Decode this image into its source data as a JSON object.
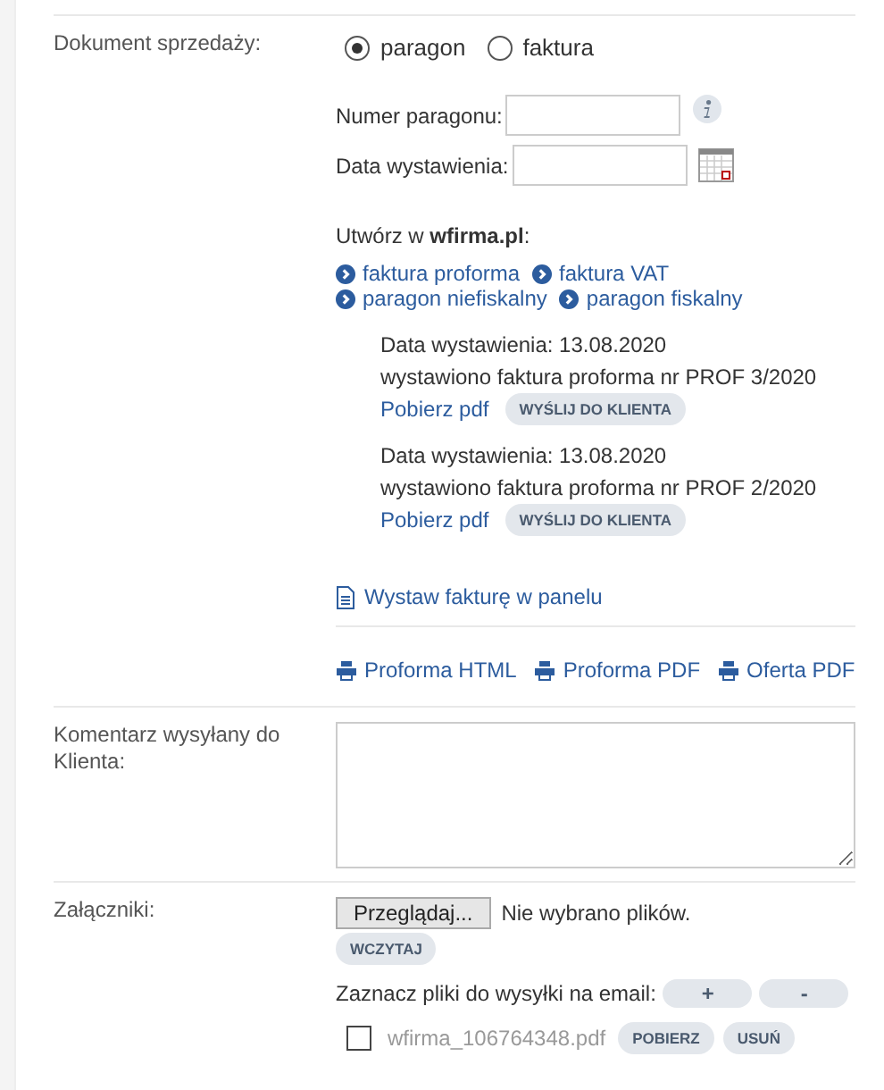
{
  "sales_document": {
    "label": "Dokument sprzedaży:",
    "options": [
      {
        "label": "paragon",
        "selected": true
      },
      {
        "label": "faktura",
        "selected": false
      }
    ],
    "fields": [
      {
        "label": "Numer paragonu:",
        "kind": "info"
      },
      {
        "label": "Data wystawienia:",
        "kind": "date"
      }
    ],
    "create_heading": "Utwórz w **wfirma.pl**:",
    "create_links": [
      "faktura proforma",
      "faktura VAT",
      "paragon niefiskalny",
      "paragon fiskalny"
    ],
    "issued": [
      {
        "date": "Data wystawienia: 13.08.2020",
        "description": "wystawiono faktura proforma nr PROF 3/2020",
        "download": "Pobierz pdf",
        "send": "WYŚLIJ DO KLIENTA"
      },
      {
        "date": "Data wystawienia: 13.08.2020",
        "description": "wystawiono faktura proforma nr PROF 2/2020",
        "download": "Pobierz pdf",
        "send": "WYŚLIJ DO KLIENTA"
      }
    ],
    "panel_link": "Wystaw fakturę w panelu",
    "print_links": [
      "Proforma HTML",
      "Proforma PDF",
      "Oferta PDF"
    ]
  },
  "comment": {
    "label": "Komentarz wysyłany do Klienta:"
  },
  "attachments": {
    "label": "Załączniki:",
    "browse": "Przeglądaj...",
    "no_file": "Nie wybrano plików.",
    "upload": "WCZYTAJ",
    "select_label": "Zaznacz pliki do wysyłki na email:",
    "select_all": "+",
    "deselect_all": "-",
    "files": [
      {
        "name": "wfirma_106764348.pdf",
        "checked": false,
        "download": "POBIERZ",
        "remove": "USUŃ"
      }
    ]
  }
}
